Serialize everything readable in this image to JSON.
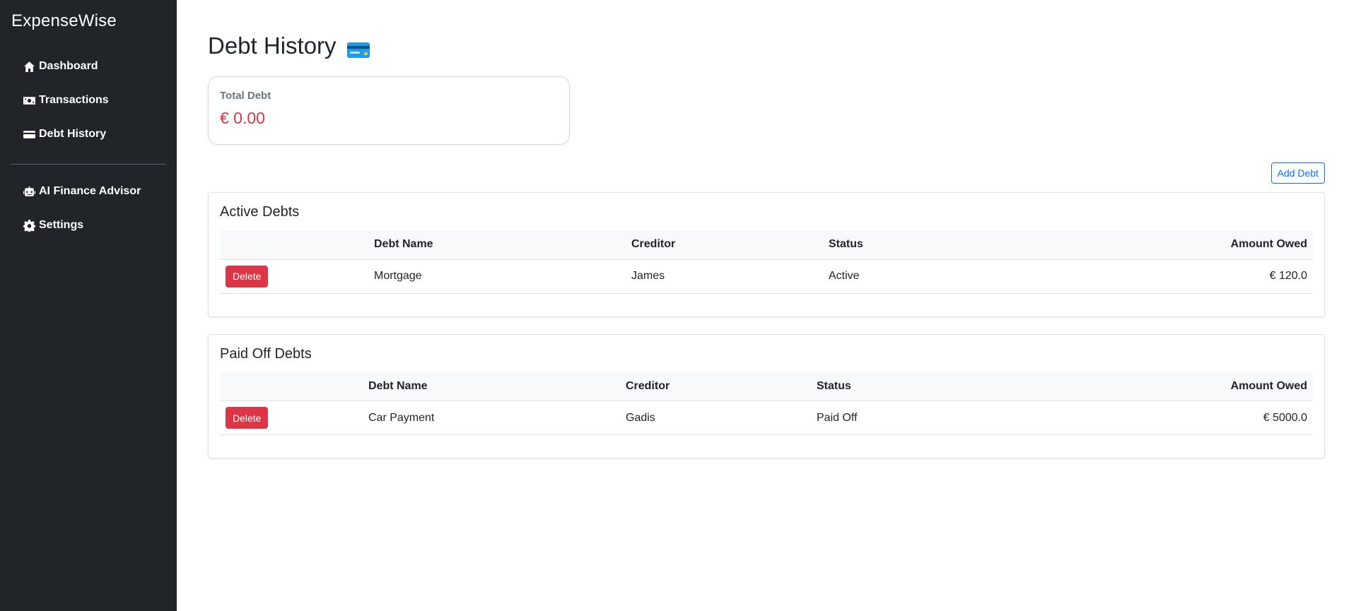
{
  "app": {
    "brand": "ExpenseWise"
  },
  "sidebar": {
    "items": [
      {
        "label": "Dashboard",
        "icon": "house-icon"
      },
      {
        "label": "Transactions",
        "icon": "money-bill-icon"
      },
      {
        "label": "Debt History",
        "icon": "credit-card-icon"
      },
      {
        "label": "AI Finance Advisor",
        "icon": "robot-icon"
      },
      {
        "label": "Settings",
        "icon": "gear-icon"
      }
    ]
  },
  "page": {
    "title": "Debt History",
    "title_icon": "credit-card-emoji-icon"
  },
  "summary": {
    "label": "Total Debt",
    "value": "€ 0.00",
    "value_color": "#dc3545"
  },
  "actions": {
    "add_debt_label": "Add Debt"
  },
  "active_debts": {
    "title": "Active Debts",
    "columns": [
      "",
      "Debt Name",
      "Creditor",
      "Status",
      "Amount Owed"
    ],
    "rows": [
      {
        "action": "Delete",
        "name": "Mortgage",
        "creditor": "James",
        "status": "Active",
        "amount": "€ 120.0"
      }
    ]
  },
  "paid_debts": {
    "title": "Paid Off Debts",
    "columns": [
      "",
      "Debt Name",
      "Creditor",
      "Status",
      "Amount Owed"
    ],
    "rows": [
      {
        "action": "Delete",
        "name": "Car Payment",
        "creditor": "Gadis",
        "status": "Paid Off",
        "amount": "€ 5000.0"
      }
    ]
  },
  "colors": {
    "sidebar_bg": "#212529",
    "primary": "#0d6efd",
    "danger": "#dc3545"
  }
}
